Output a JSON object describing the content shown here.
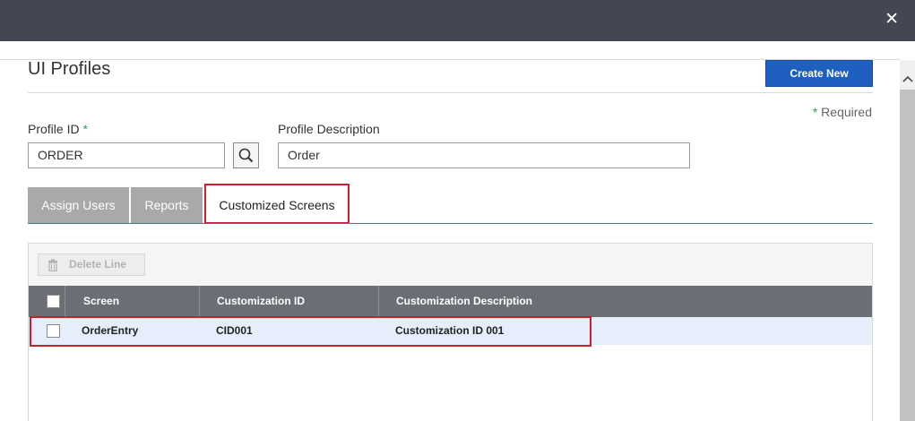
{
  "window": {
    "close_icon": "close-icon",
    "close_glyph": "✕"
  },
  "header": {
    "title": "UI Profiles",
    "create_new_label": "Create New",
    "required_star": "*",
    "required_text": "Required"
  },
  "form": {
    "profile_id_label": "Profile ID",
    "profile_id_star": "*",
    "profile_id_value": "ORDER",
    "profile_description_label": "Profile Description",
    "profile_description_value": "Order",
    "search_icon": "search-icon"
  },
  "tabs": [
    {
      "label": "Assign Users",
      "active": false
    },
    {
      "label": "Reports",
      "active": false
    },
    {
      "label": "Customized Screens",
      "active": true
    }
  ],
  "toolbar": {
    "delete_line_label": "Delete Line",
    "delete_icon": "trash-icon"
  },
  "grid": {
    "columns": [
      "Screen",
      "Customization ID",
      "Customization Description"
    ],
    "rows": [
      {
        "screen": "OrderEntry",
        "customization_id": "CID001",
        "customization_description": "Customization ID 001",
        "selected": false
      }
    ]
  },
  "colors": {
    "topbar": "#424753",
    "primary_button": "#1f5fbf",
    "highlight": "#c8202c",
    "required_star": "#2a9d50",
    "grid_header": "#6b6e75",
    "row_selected": "#e6eefb"
  }
}
